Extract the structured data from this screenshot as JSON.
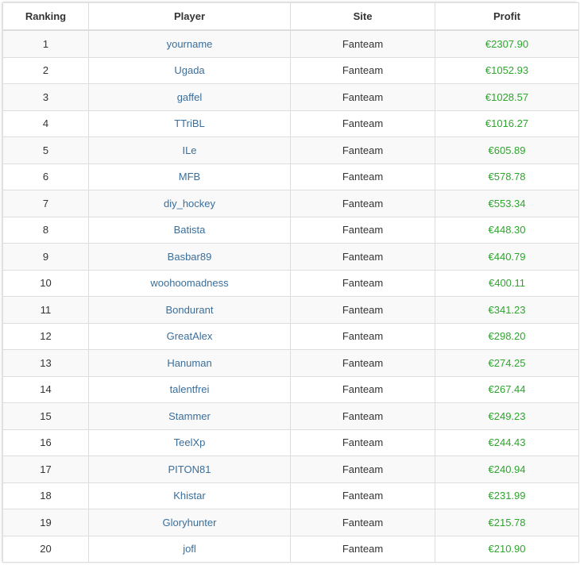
{
  "table": {
    "headers": {
      "ranking": "Ranking",
      "player": "Player",
      "site": "Site",
      "profit": "Profit"
    },
    "rows": [
      {
        "rank": "1",
        "player": "yourname",
        "site": "Fanteam",
        "profit": "€2307.90"
      },
      {
        "rank": "2",
        "player": "Ugada",
        "site": "Fanteam",
        "profit": "€1052.93"
      },
      {
        "rank": "3",
        "player": "gaffel",
        "site": "Fanteam",
        "profit": "€1028.57"
      },
      {
        "rank": "4",
        "player": "TTriBL",
        "site": "Fanteam",
        "profit": "€1016.27"
      },
      {
        "rank": "5",
        "player": "ILe",
        "site": "Fanteam",
        "profit": "€605.89"
      },
      {
        "rank": "6",
        "player": "MFB",
        "site": "Fanteam",
        "profit": "€578.78"
      },
      {
        "rank": "7",
        "player": "diy_hockey",
        "site": "Fanteam",
        "profit": "€553.34"
      },
      {
        "rank": "8",
        "player": "Batista",
        "site": "Fanteam",
        "profit": "€448.30"
      },
      {
        "rank": "9",
        "player": "Basbar89",
        "site": "Fanteam",
        "profit": "€440.79"
      },
      {
        "rank": "10",
        "player": "woohoomadness",
        "site": "Fanteam",
        "profit": "€400.11"
      },
      {
        "rank": "11",
        "player": "Bondurant",
        "site": "Fanteam",
        "profit": "€341.23"
      },
      {
        "rank": "12",
        "player": "GreatAlex",
        "site": "Fanteam",
        "profit": "€298.20"
      },
      {
        "rank": "13",
        "player": "Hanuman",
        "site": "Fanteam",
        "profit": "€274.25"
      },
      {
        "rank": "14",
        "player": "talentfrei",
        "site": "Fanteam",
        "profit": "€267.44"
      },
      {
        "rank": "15",
        "player": "Stammer",
        "site": "Fanteam",
        "profit": "€249.23"
      },
      {
        "rank": "16",
        "player": "TeelXp",
        "site": "Fanteam",
        "profit": "€244.43"
      },
      {
        "rank": "17",
        "player": "PITON81",
        "site": "Fanteam",
        "profit": "€240.94"
      },
      {
        "rank": "18",
        "player": "Khistar",
        "site": "Fanteam",
        "profit": "€231.99"
      },
      {
        "rank": "19",
        "player": "Gloryhunter",
        "site": "Fanteam",
        "profit": "€215.78"
      },
      {
        "rank": "20",
        "player": "jofl",
        "site": "Fanteam",
        "profit": "€210.90"
      }
    ]
  },
  "colors": {
    "player_link": "#3a6e9b",
    "profit": "#2ea52e",
    "stripe": "#f9f9f9",
    "border": "#dddddd"
  }
}
